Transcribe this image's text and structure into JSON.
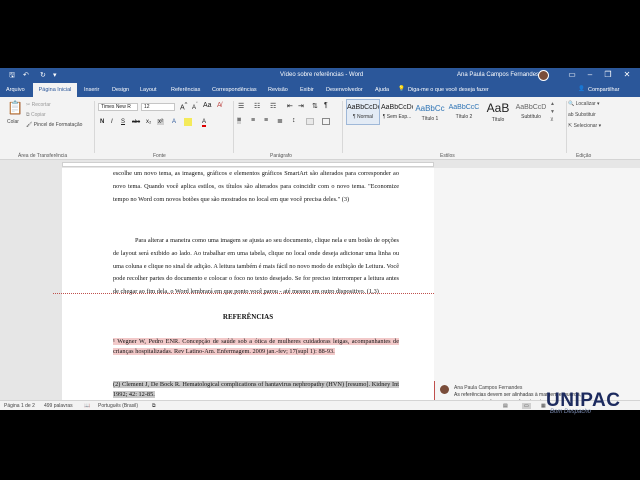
{
  "window": {
    "title": "Vídeo sobre referências  -  Word",
    "user": "Ana Paula Campos Fernandes"
  },
  "tabs": [
    "Arquivo",
    "Página Inicial",
    "Inserir",
    "Design",
    "Layout",
    "Referências",
    "Correspondências",
    "Revisão",
    "Exibir",
    "Desenvolvedor",
    "Ajuda"
  ],
  "tell_me": "Diga-me o que você deseja fazer",
  "share": "Compartilhar",
  "ribbon": {
    "clipboard": {
      "paste": "Colar",
      "cut": "Recortar",
      "copy": "Copiar",
      "format_painter": "Pincel de Formatação",
      "label": "Área de Transferência"
    },
    "font": {
      "name": "Times New R",
      "size": "12",
      "label": "Fonte",
      "buttons": [
        "N",
        "I",
        "S",
        "abc",
        "x₂",
        "x²",
        "A",
        "A"
      ]
    },
    "paragraph": {
      "label": "Parágrafo"
    },
    "styles": {
      "label": "Estilos",
      "items": [
        {
          "preview": "AaBbCcDc",
          "name": "¶ Normal"
        },
        {
          "preview": "AaBbCcDc",
          "name": "¶ Sem Esp..."
        },
        {
          "preview": "AaBbCc",
          "name": "Título 1"
        },
        {
          "preview": "AaBbCcC",
          "name": "Título 2"
        },
        {
          "preview": "AaB",
          "name": "Título"
        },
        {
          "preview": "AaBbCcD",
          "name": "Subtítulo"
        }
      ]
    },
    "editing": {
      "label": "Edição",
      "find": "Localizar",
      "replace": "Substituir",
      "select": "Selecionar"
    }
  },
  "document": {
    "para1": "escolhe um novo tema, as imagens, gráficos e elementos gráficos SmartArt são alterados para corresponder ao novo tema. Quando você aplica estilos, os títulos são alterados para coincidir com o novo tema. \"Economize tempo no Word com novos botões que são mostrados no local em que você precisa deles.\" (3)",
    "para2": "Para alterar a maneira como uma imagem se ajusta ao seu documento, clique nela e um botão de opções de layout será exibido ao lado. Ao trabalhar em uma tabela, clique no local onde deseja adicionar uma linha ou uma coluna e clique no sinal de adição. A leitura também é mais fácil no novo modo de exibição de Leitura. Você pode recolher partes do documento e colocar o foco no texto desejado. Se for preciso interromper a leitura antes de chegar ao fim dela, o Word lembrará em que ponto você parou - até mesmo em outro dispositivo. (1,3)",
    "references_heading": "REFERÊNCIAS",
    "ref1": "¹ Wegner W, Pedro ENR. Concepção de saúde sob a ótica de mulheres cuidadoras leigas, acompanhantes de crianças hospitalizadas. Rev Latino-Am. Enfermagem. 2009 jan.-fev; 17(supl 1): 88-93.",
    "ref2": "(2) Clement J, De Bock R. Hematological complications of hantavirus nephropathy (HVN) [resumo]. Kidney Int 1992; 42: 12-85."
  },
  "comment": {
    "author": "Ana Paula Campos Fernandes",
    "text": "As referências devem ser alinhadas à margem esquerda, em espaço simples e separado entre si por espaço duplo;"
  },
  "status": {
    "page": "Página 1 de 2",
    "words": "499 palavras",
    "language": "Português (Brasil)"
  },
  "logo": {
    "name": "UNIPAC",
    "tagline": "Bom Despacho"
  }
}
